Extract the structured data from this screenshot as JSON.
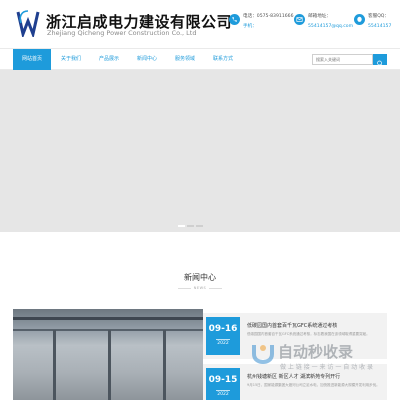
{
  "brand": {
    "name_cn": "浙江启成电力建设有限公司",
    "name_en": "Zhejiang Qicheng Power Construction Co., Ltd"
  },
  "contacts": [
    {
      "label": "电话：0575-83911666",
      "sub": "手机："
    },
    {
      "label": "邮箱地址：",
      "sub": "55414157@qq.com"
    },
    {
      "label": "客服QQ：",
      "sub": "55414157"
    }
  ],
  "nav": {
    "items": [
      "网站首页",
      "关于我们",
      "产品展示",
      "新闻中心",
      "服务领域",
      "联系方式"
    ],
    "active_index": 0
  },
  "search": {
    "placeholder": "搜索入关键词"
  },
  "banner": {
    "slide_count": 3,
    "active_slide": 1
  },
  "news": {
    "title": "新闻中心",
    "subtitle": "NEWS",
    "items": [
      {
        "day": "09-16",
        "year": "2022",
        "title": "低碳园国内首套百千瓦GFC系统通过考核",
        "excerpt": "低碳园国内首套百千瓦GFC系统通过考核，标志着我国在该领域取得重要突破。"
      },
      {
        "day": "09-15",
        "year": "2022",
        "title": "杭州钱塘新区 新区人才 湖滨新苑专列开行",
        "excerpt": "9月15日，国家能源集团大渡河公司立足水电，加快推进新能源大规模开发利用步伐。"
      }
    ]
  },
  "watermark": {
    "text": "自动秒收录",
    "sub": "做 上 链 接 一 来 访 一 自 动 收 录"
  },
  "colors": {
    "accent": "#1e9bdb"
  }
}
